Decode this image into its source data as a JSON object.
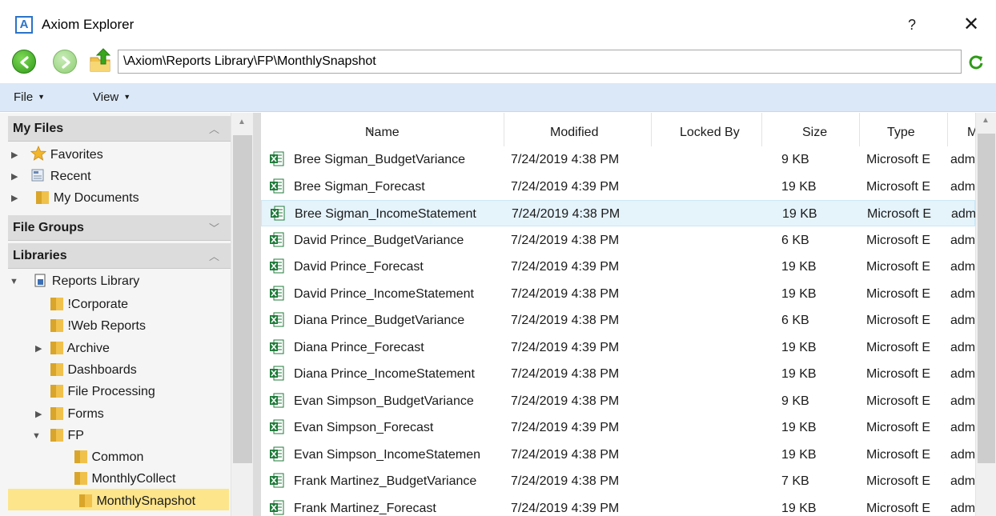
{
  "window": {
    "title": "Axiom Explorer",
    "help": "?",
    "close": "✕",
    "app_icon_letter": "A"
  },
  "address": {
    "path": "\\Axiom\\Reports Library\\FP\\MonthlySnapshot"
  },
  "menu": {
    "file": "File",
    "view": "View"
  },
  "sidebar": {
    "my_files": {
      "header": "My Files",
      "items": [
        {
          "label": "Favorites",
          "icon": "star-icon"
        },
        {
          "label": "Recent",
          "icon": "recent-icon"
        },
        {
          "label": "My Documents",
          "icon": "folder-icon"
        }
      ]
    },
    "file_groups": {
      "header": "File Groups"
    },
    "libraries": {
      "header": "Libraries",
      "root": "Reports Library",
      "folders": [
        {
          "label": "!Corporate"
        },
        {
          "label": "!Web Reports"
        },
        {
          "label": "Archive"
        },
        {
          "label": "Dashboards"
        },
        {
          "label": "File Processing"
        },
        {
          "label": "Forms"
        },
        {
          "label": "FP"
        }
      ],
      "fp_children": [
        {
          "label": "Common"
        },
        {
          "label": "MonthlyCollect"
        },
        {
          "label": "MonthlySnapshot"
        }
      ]
    }
  },
  "files": {
    "columns": [
      "Name",
      "Modified",
      "Locked By",
      "Size",
      "Type",
      "M"
    ],
    "rows": [
      {
        "name": "Bree Sigman_BudgetVariance",
        "modified": "7/24/2019 4:38 PM",
        "locked_by": "",
        "size": "9 KB",
        "type": "Microsoft E",
        "m": "adm"
      },
      {
        "name": "Bree Sigman_Forecast",
        "modified": "7/24/2019 4:39 PM",
        "locked_by": "",
        "size": "19 KB",
        "type": "Microsoft E",
        "m": "adm"
      },
      {
        "name": "Bree Sigman_IncomeStatement",
        "modified": "7/24/2019 4:38 PM",
        "locked_by": "",
        "size": "19 KB",
        "type": "Microsoft E",
        "m": "adm"
      },
      {
        "name": "David Prince_BudgetVariance",
        "modified": "7/24/2019 4:38 PM",
        "locked_by": "",
        "size": "6 KB",
        "type": "Microsoft E",
        "m": "adm"
      },
      {
        "name": "David Prince_Forecast",
        "modified": "7/24/2019 4:39 PM",
        "locked_by": "",
        "size": "19 KB",
        "type": "Microsoft E",
        "m": "adm"
      },
      {
        "name": "David Prince_IncomeStatement",
        "modified": "7/24/2019 4:38 PM",
        "locked_by": "",
        "size": "19 KB",
        "type": "Microsoft E",
        "m": "adm"
      },
      {
        "name": "Diana Prince_BudgetVariance",
        "modified": "7/24/2019 4:38 PM",
        "locked_by": "",
        "size": "6 KB",
        "type": "Microsoft E",
        "m": "adm"
      },
      {
        "name": "Diana Prince_Forecast",
        "modified": "7/24/2019 4:39 PM",
        "locked_by": "",
        "size": "19 KB",
        "type": "Microsoft E",
        "m": "adm"
      },
      {
        "name": "Diana Prince_IncomeStatement",
        "modified": "7/24/2019 4:38 PM",
        "locked_by": "",
        "size": "19 KB",
        "type": "Microsoft E",
        "m": "adm"
      },
      {
        "name": "Evan Simpson_BudgetVariance",
        "modified": "7/24/2019 4:38 PM",
        "locked_by": "",
        "size": "9 KB",
        "type": "Microsoft E",
        "m": "adm"
      },
      {
        "name": "Evan Simpson_Forecast",
        "modified": "7/24/2019 4:39 PM",
        "locked_by": "",
        "size": "19 KB",
        "type": "Microsoft E",
        "m": "adm"
      },
      {
        "name": "Evan Simpson_IncomeStatemen",
        "modified": "7/24/2019 4:38 PM",
        "locked_by": "",
        "size": "19 KB",
        "type": "Microsoft E",
        "m": "adm"
      },
      {
        "name": "Frank Martinez_BudgetVariance",
        "modified": "7/24/2019 4:38 PM",
        "locked_by": "",
        "size": "7 KB",
        "type": "Microsoft E",
        "m": "adm"
      },
      {
        "name": "Frank Martinez_Forecast",
        "modified": "7/24/2019 4:39 PM",
        "locked_by": "",
        "size": "19 KB",
        "type": "Microsoft E",
        "m": "adm"
      }
    ],
    "hovered_row": 2
  },
  "colors": {
    "menubar": "#dbe8f7",
    "selected": "#fce58b",
    "hover": "#e5f3fb",
    "excel_green": "#1f7a3a"
  }
}
